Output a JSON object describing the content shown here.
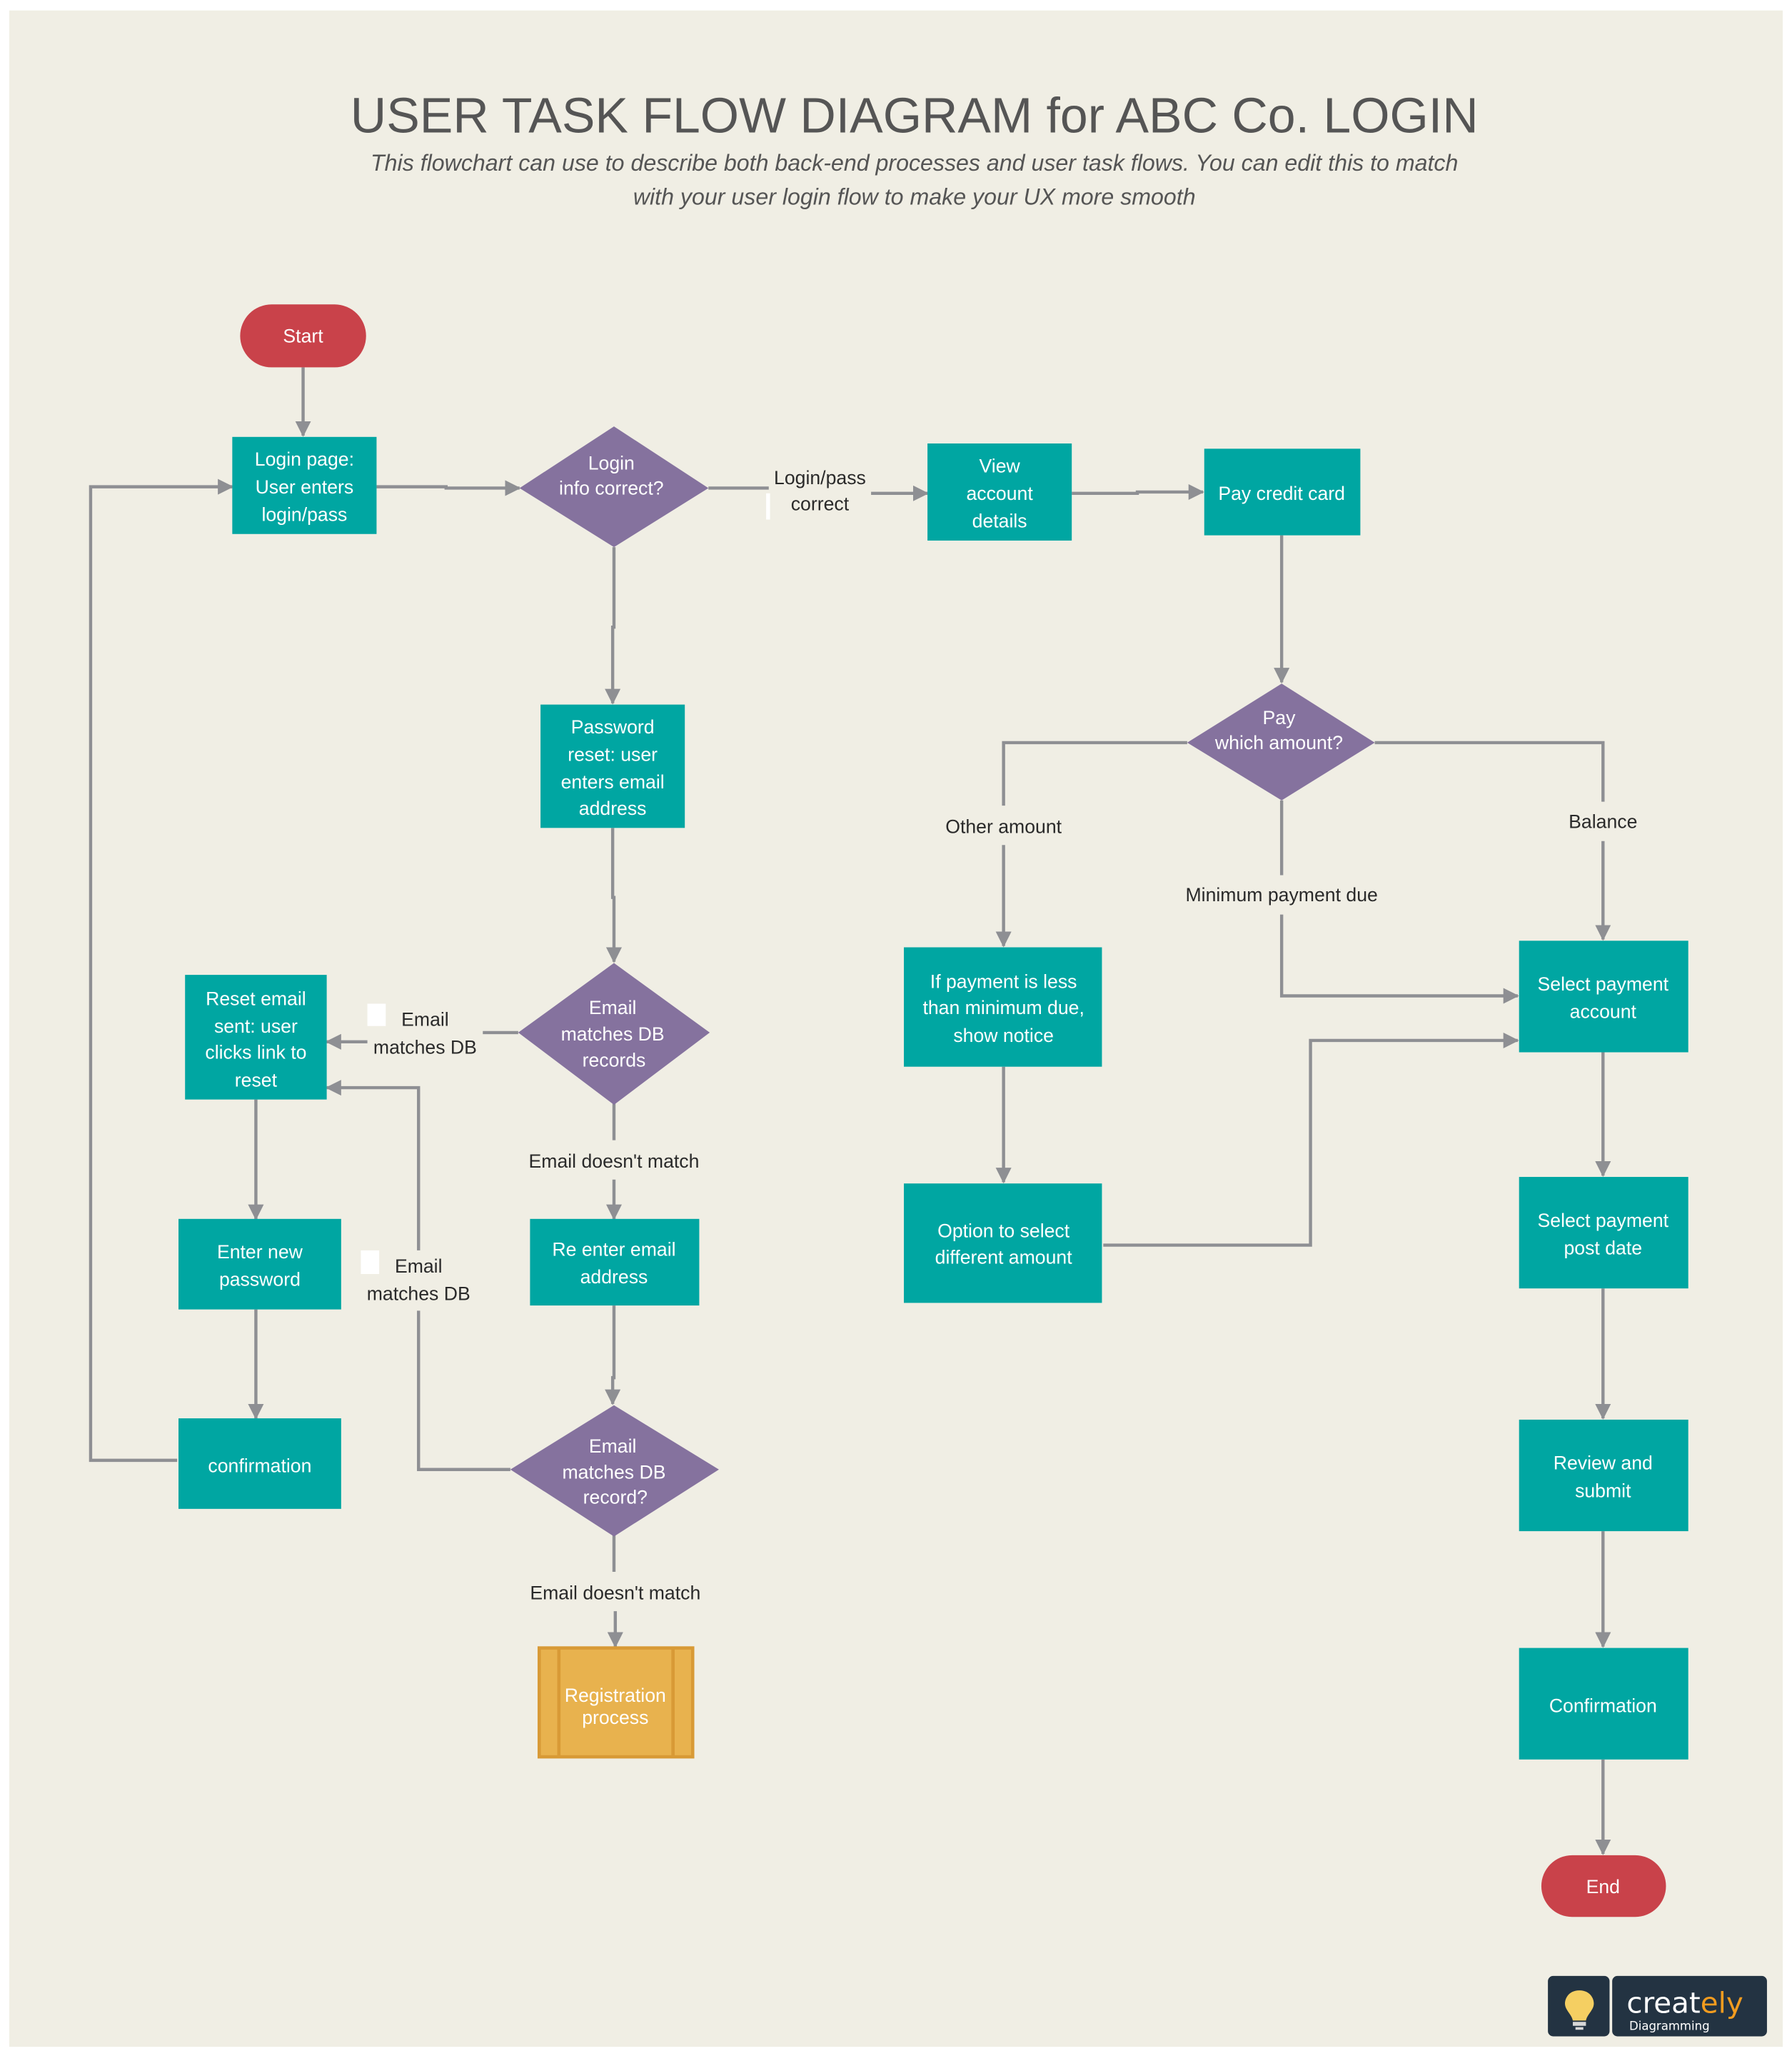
{
  "header": {
    "title": "USER TASK FLOW DIAGRAM for ABC Co. LOGIN",
    "subtitle_lines": [
      "This flowchart can use to describe both back-end processes and user task flows. You can edit this to match",
      "with your user login flow to make your UX more smooth"
    ]
  },
  "colors": {
    "background": "#f0eee4",
    "process": "#00a6a2",
    "decision": "#85729e",
    "terminator": "#c9424a",
    "subprocess": "#e8b24e",
    "subprocess_border": "#d89a36",
    "connector": "#8e8f93",
    "label_text": "#2a2a2a"
  },
  "nodes": {
    "start": {
      "type": "terminator",
      "lines": [
        "Start"
      ]
    },
    "login_page": {
      "type": "process",
      "lines": [
        "Login page:",
        "User enters",
        "login/pass"
      ]
    },
    "login_correct": {
      "type": "decision",
      "lines": [
        "Login",
        "info correct?"
      ]
    },
    "view_account": {
      "type": "process",
      "lines": [
        "View",
        "account",
        "details"
      ]
    },
    "pay_credit_card": {
      "type": "process",
      "lines": [
        "Pay credit card"
      ]
    },
    "password_reset": {
      "type": "process",
      "lines": [
        "Password",
        "reset: user",
        "enters email",
        "address"
      ]
    },
    "email_matches_1": {
      "type": "decision",
      "lines": [
        "Email",
        "matches  DB",
        "records"
      ]
    },
    "reset_email_sent": {
      "type": "process",
      "lines": [
        "Reset email",
        "sent: user",
        "clicks link to",
        "reset"
      ]
    },
    "enter_new_password": {
      "type": "process",
      "lines": [
        "Enter new",
        "password"
      ]
    },
    "confirmation_left": {
      "type": "process",
      "lines": [
        "confirmation"
      ]
    },
    "reenter_email": {
      "type": "process",
      "lines": [
        "Re enter email",
        "address"
      ]
    },
    "email_matches_2": {
      "type": "decision",
      "lines": [
        "Email",
        "matches  DB",
        "record?"
      ]
    },
    "registration": {
      "type": "subprocess",
      "lines": [
        "Registration",
        "process"
      ]
    },
    "pay_which": {
      "type": "decision",
      "lines": [
        "Pay",
        "which amount?"
      ]
    },
    "payment_less": {
      "type": "process",
      "lines": [
        "If payment is less",
        "than minimum due,",
        "show notice"
      ]
    },
    "option_select": {
      "type": "process",
      "lines": [
        "Option to select",
        "different amount"
      ]
    },
    "select_account": {
      "type": "process",
      "lines": [
        "Select payment",
        "account"
      ]
    },
    "select_post_date": {
      "type": "process",
      "lines": [
        "Select payment",
        "post date"
      ]
    },
    "review_submit": {
      "type": "process",
      "lines": [
        "Review and",
        "submit"
      ]
    },
    "confirmation_right": {
      "type": "process",
      "lines": [
        "Confirmation"
      ]
    },
    "end": {
      "type": "terminator",
      "lines": [
        "End"
      ]
    }
  },
  "edge_labels": {
    "login_pass_correct": [
      "Login/pass",
      "correct"
    ],
    "email_matches_db_1": [
      "Email",
      "matches DB"
    ],
    "email_doesnt_match_1": [
      "Email doesn't match"
    ],
    "email_matches_db_2": [
      "Email",
      "matches DB"
    ],
    "email_doesnt_match_2": [
      "Email doesn't match"
    ],
    "other_amount": [
      "Other amount"
    ],
    "minimum_payment_due": [
      "Minimum payment due"
    ],
    "balance": [
      "Balance"
    ]
  },
  "logo": {
    "brand": "creat",
    "brand_accent": "ely",
    "tagline": "Diagramming",
    "icon": "lightbulb-icon"
  }
}
